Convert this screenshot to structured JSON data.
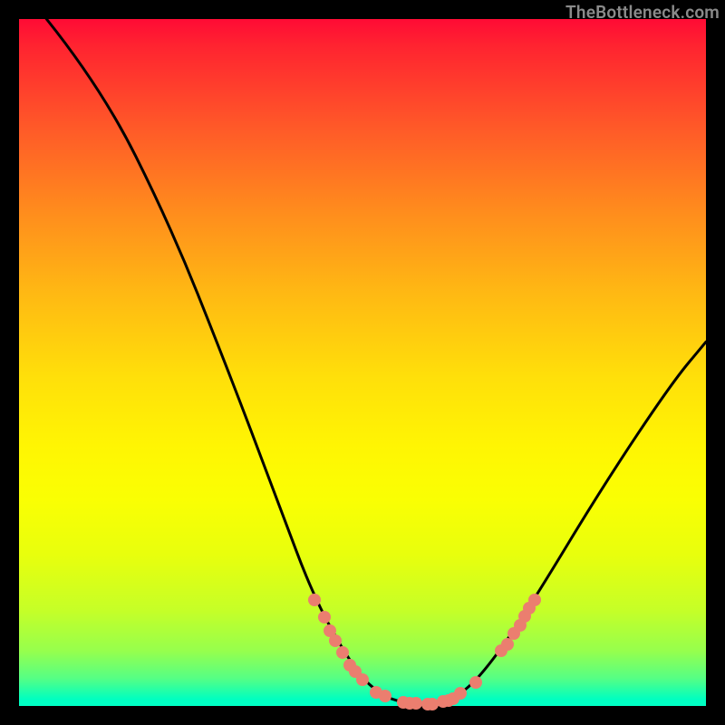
{
  "attribution": "TheBottleneck.com",
  "chart_data": {
    "type": "line",
    "title": "",
    "xlabel": "",
    "ylabel": "",
    "xlim": [
      0,
      100
    ],
    "ylim": [
      0,
      100
    ],
    "curve": {
      "name": "bottleneck-curve",
      "points": [
        {
          "x": 4.0,
          "y": 100.0
        },
        {
          "x": 12.0,
          "y": 90.0
        },
        {
          "x": 22.0,
          "y": 70.0
        },
        {
          "x": 30.0,
          "y": 50.0
        },
        {
          "x": 37.6,
          "y": 30.0
        },
        {
          "x": 43.0,
          "y": 15.5
        },
        {
          "x": 49.0,
          "y": 5.0
        },
        {
          "x": 53.0,
          "y": 1.3
        },
        {
          "x": 57.0,
          "y": 0.3
        },
        {
          "x": 61.5,
          "y": 0.3
        },
        {
          "x": 65.5,
          "y": 2.5
        },
        {
          "x": 70.0,
          "y": 8.0
        },
        {
          "x": 75.0,
          "y": 15.5
        },
        {
          "x": 85.0,
          "y": 32.0
        },
        {
          "x": 95.0,
          "y": 47.0
        },
        {
          "x": 100.0,
          "y": 53.0
        }
      ]
    },
    "markers": [
      {
        "x": 43.0,
        "y": 15.5
      },
      {
        "x": 44.4,
        "y": 12.9
      },
      {
        "x": 45.2,
        "y": 11.0
      },
      {
        "x": 46.1,
        "y": 9.5
      },
      {
        "x": 47.1,
        "y": 7.8
      },
      {
        "x": 48.2,
        "y": 6.0
      },
      {
        "x": 49.0,
        "y": 5.0
      },
      {
        "x": 50.0,
        "y": 3.8
      },
      {
        "x": 52.0,
        "y": 2.0
      },
      {
        "x": 53.3,
        "y": 1.4
      },
      {
        "x": 55.9,
        "y": 0.5
      },
      {
        "x": 56.8,
        "y": 0.4
      },
      {
        "x": 57.8,
        "y": 0.4
      },
      {
        "x": 59.5,
        "y": 0.3
      },
      {
        "x": 60.2,
        "y": 0.3
      },
      {
        "x": 61.8,
        "y": 0.6
      },
      {
        "x": 62.5,
        "y": 0.8
      },
      {
        "x": 63.2,
        "y": 1.1
      },
      {
        "x": 64.3,
        "y": 1.9
      },
      {
        "x": 66.5,
        "y": 3.4
      },
      {
        "x": 70.2,
        "y": 8.0
      },
      {
        "x": 71.1,
        "y": 9.0
      },
      {
        "x": 72.0,
        "y": 10.5
      },
      {
        "x": 72.9,
        "y": 11.8
      },
      {
        "x": 73.6,
        "y": 13.0
      },
      {
        "x": 74.3,
        "y": 14.2
      },
      {
        "x": 75.0,
        "y": 15.5
      }
    ],
    "colors": {
      "curve": "#000000",
      "marker": "#eb7e6f",
      "gradient_top": "#ff0b35",
      "gradient_bottom": "#00ffc4"
    }
  }
}
